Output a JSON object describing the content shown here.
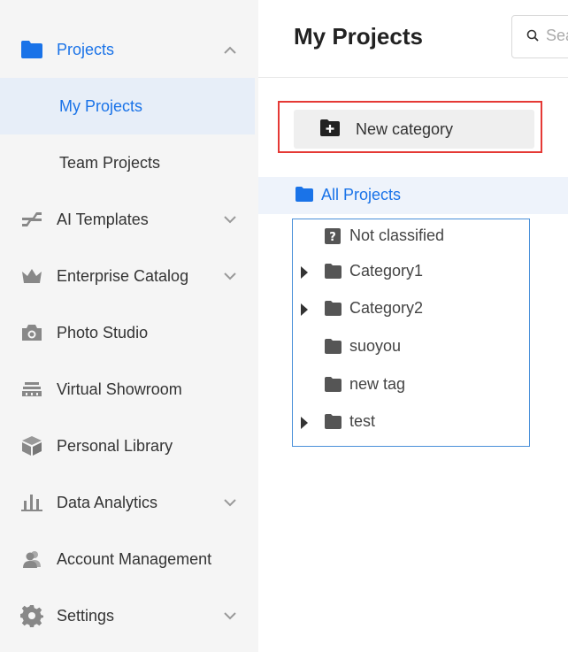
{
  "sidebar": {
    "items": [
      {
        "label": "Projects",
        "icon": "folder-icon"
      },
      {
        "label": "AI Templates",
        "icon": "ai-templates-icon"
      },
      {
        "label": "Enterprise Catalog",
        "icon": "crown-icon"
      },
      {
        "label": "Photo Studio",
        "icon": "camera-icon"
      },
      {
        "label": "Virtual Showroom",
        "icon": "showroom-icon"
      },
      {
        "label": "Personal Library",
        "icon": "cube-icon"
      },
      {
        "label": "Data Analytics",
        "icon": "bar-chart-icon"
      },
      {
        "label": "Account Management",
        "icon": "users-icon"
      },
      {
        "label": "Settings",
        "icon": "gear-icon"
      }
    ],
    "subitems": [
      {
        "label": "My Projects"
      },
      {
        "label": "Team Projects"
      }
    ]
  },
  "header": {
    "title": "My Projects",
    "search_placeholder": "Search"
  },
  "toolbar": {
    "new_category_label": "New category"
  },
  "tree": {
    "root_label": "All Projects",
    "items": [
      {
        "label": "Not classified",
        "icon": "question-icon",
        "expandable": false
      },
      {
        "label": "Category1",
        "icon": "folder-icon",
        "expandable": true
      },
      {
        "label": "Category2",
        "icon": "folder-icon",
        "expandable": true
      },
      {
        "label": "suoyou",
        "icon": "folder-icon",
        "expandable": false
      },
      {
        "label": "new tag",
        "icon": "folder-icon",
        "expandable": false
      },
      {
        "label": "test",
        "icon": "folder-icon",
        "expandable": true
      }
    ]
  },
  "colors": {
    "accent": "#1a73e8",
    "sidebar_bg": "#f5f5f5",
    "active_bg": "#e7eef8",
    "highlight": "#e53935",
    "tree_border": "#4a90d9"
  }
}
